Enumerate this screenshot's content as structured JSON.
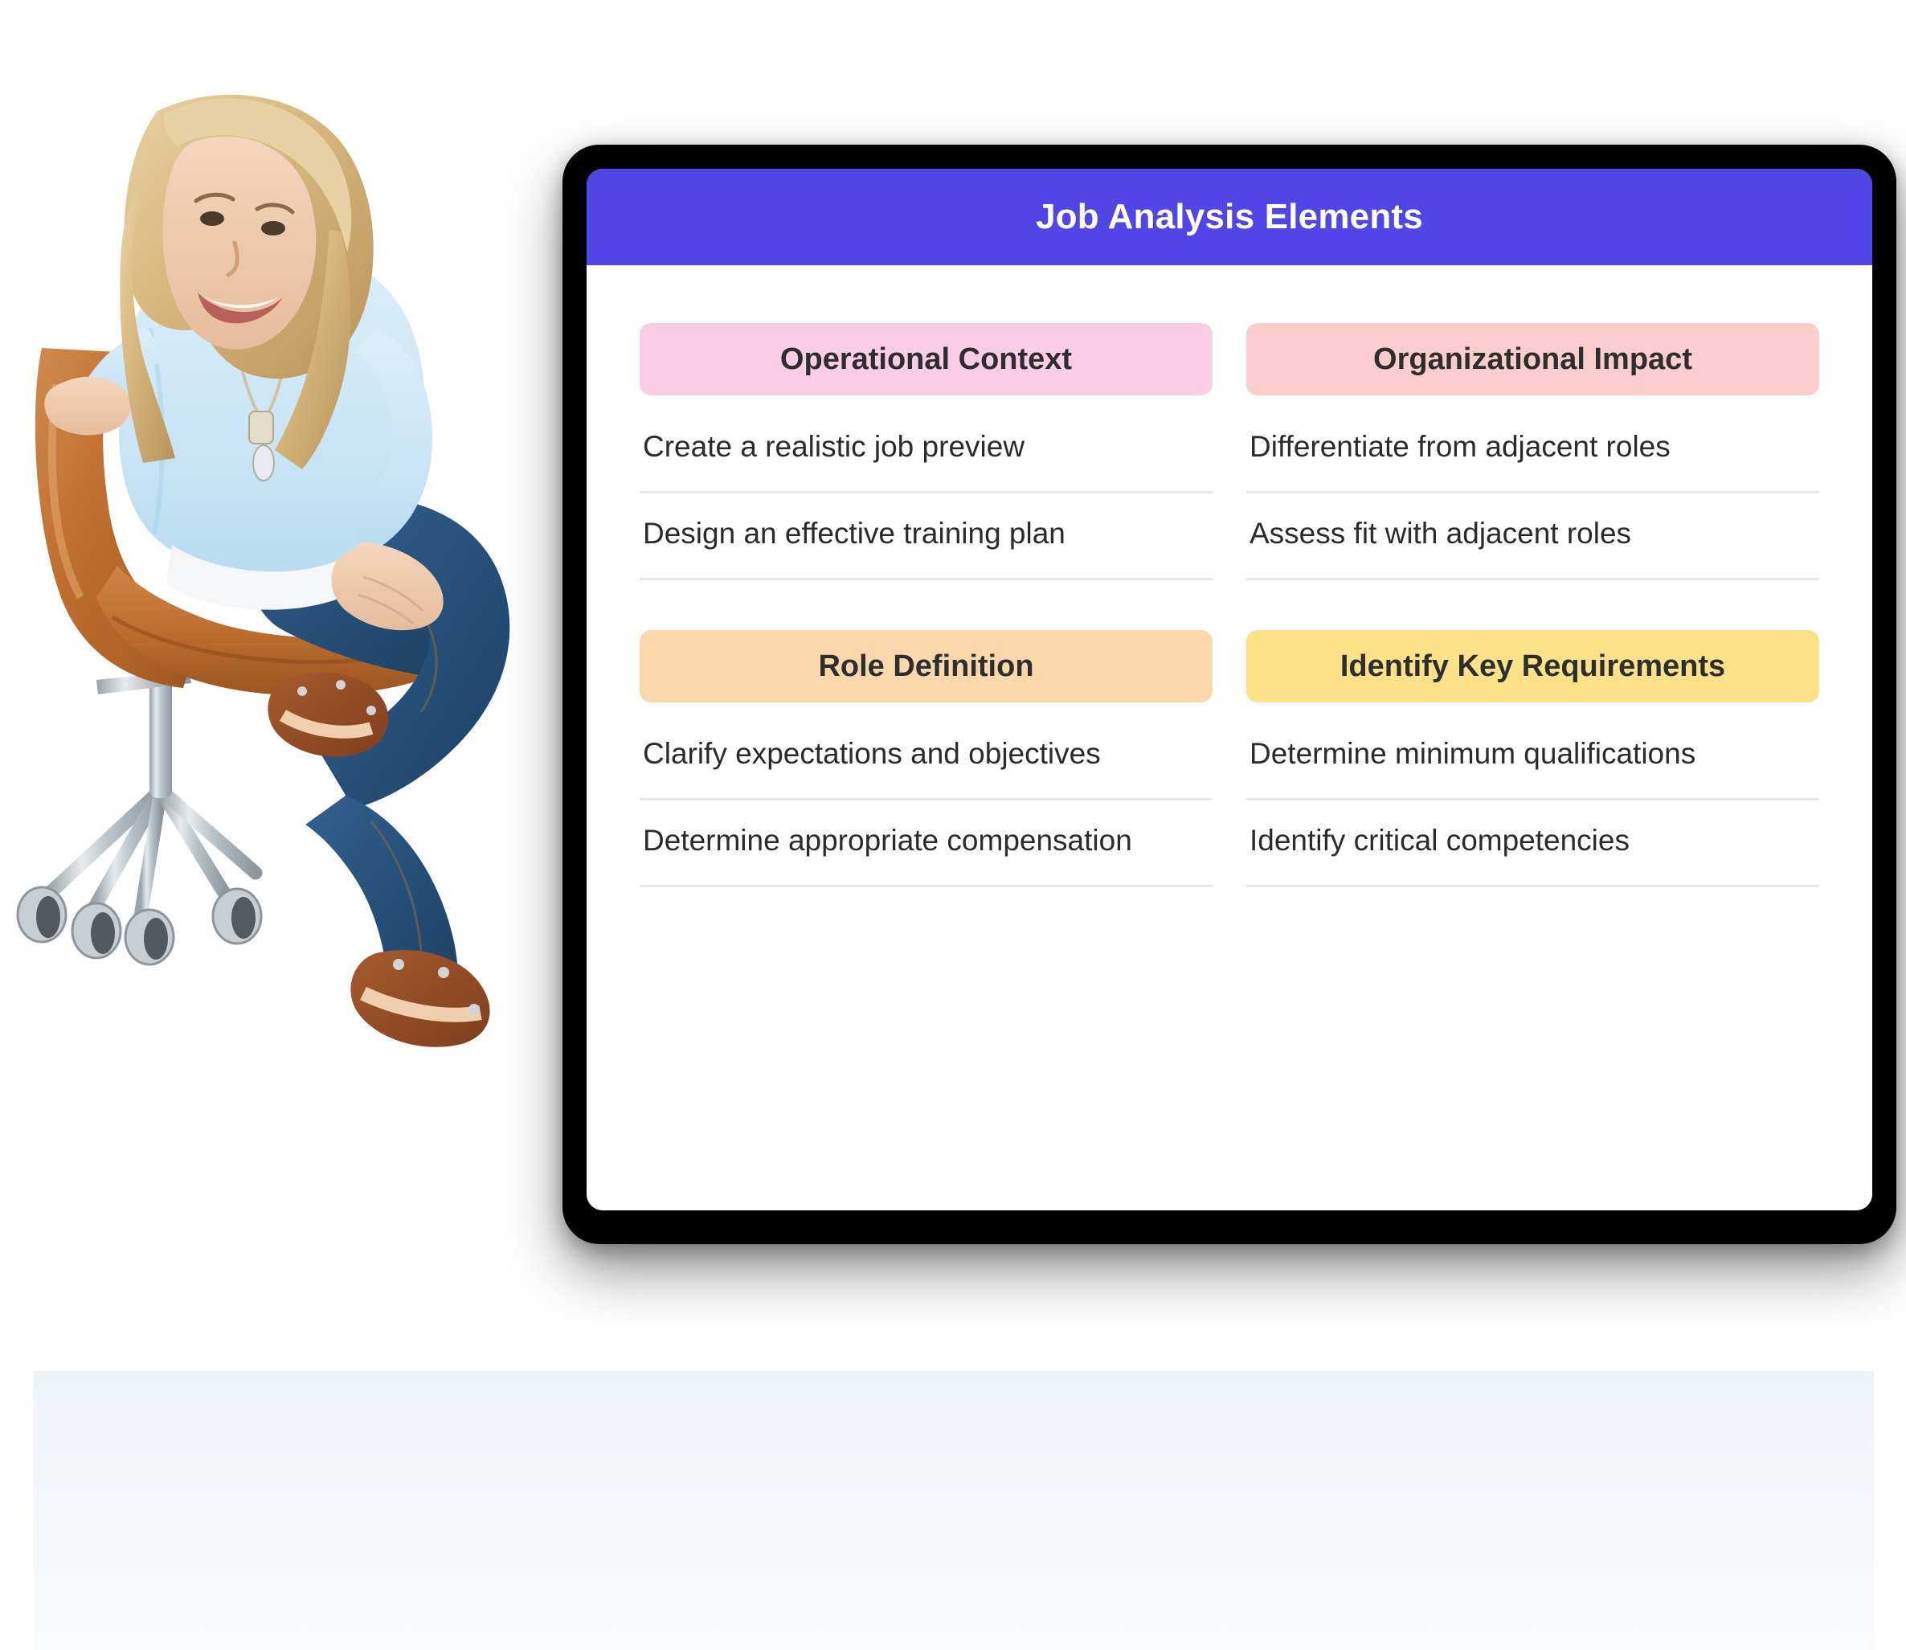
{
  "card": {
    "title": "Job Analysis Elements",
    "header_color": "#5046e5",
    "header_text_color": "#ffffff",
    "background_color": "#ffffff",
    "divider_color": "#e8e6f6",
    "body_text_color": "#2b2b2b",
    "panels": [
      {
        "title": "Operational Context",
        "accent_color": "#f9cde6",
        "items": [
          "Create a realistic job preview",
          "Design an effective training plan"
        ]
      },
      {
        "title": "Organizational Impact",
        "accent_color": "#fbcdcd",
        "items": [
          "Differentiate from adjacent roles",
          "Assess fit with adjacent roles"
        ]
      },
      {
        "title": "Role Definition",
        "accent_color": "#fbd8ac",
        "items": [
          "Clarify expectations and objectives",
          "Determine appropriate compensation"
        ]
      },
      {
        "title": "Identify Key Requirements",
        "accent_color": "#fbe188",
        "items": [
          "Determine minimum qualifications",
          "Identify critical competencies"
        ]
      }
    ]
  },
  "scene": {
    "device_bezel_color": "#000000",
    "floor_color": "#eef3f8",
    "page_background": "#ffffff",
    "photo_subject": "smiling blonde woman seated on a tan leather office chair",
    "photo_colors": {
      "blouse": "#cbe6f6",
      "jeans": "#27527c",
      "leather_chair": "#c0702f",
      "chrome": "#b9c2c8",
      "sandals": "#a85a2e",
      "hair": "#d8b97f"
    }
  }
}
